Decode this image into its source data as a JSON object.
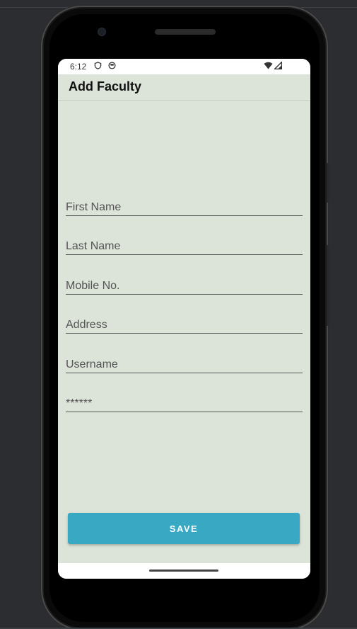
{
  "status_bar": {
    "time": "6:12",
    "left_icons": [
      "shield-icon",
      "privacy-icon"
    ],
    "right_icons": [
      "wifi-icon",
      "signal-icon"
    ]
  },
  "app_bar": {
    "title": "Add Faculty"
  },
  "form": {
    "fields": [
      {
        "name": "first-name",
        "placeholder": "First Name",
        "value": ""
      },
      {
        "name": "last-name",
        "placeholder": "Last Name",
        "value": ""
      },
      {
        "name": "mobile-no",
        "placeholder": "Mobile No.",
        "value": ""
      },
      {
        "name": "address",
        "placeholder": "Address",
        "value": ""
      },
      {
        "name": "username",
        "placeholder": "Username",
        "value": ""
      },
      {
        "name": "password",
        "placeholder": "******",
        "value": ""
      }
    ],
    "save_label": "SAVE"
  },
  "colors": {
    "background": "#dce3d8",
    "accent": "#38a8c3"
  }
}
